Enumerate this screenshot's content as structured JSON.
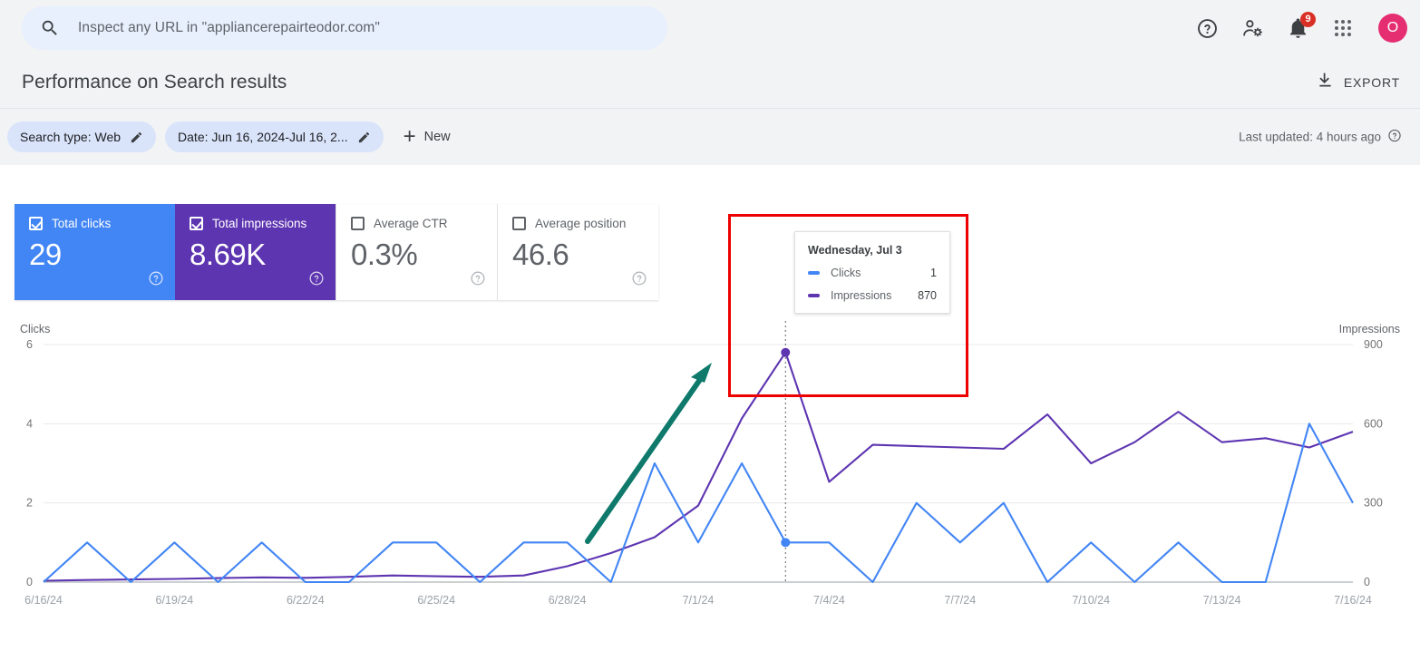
{
  "search": {
    "placeholder": "Inspect any URL in \"appliancerepairteodor.com\"",
    "icon": "search-icon"
  },
  "topbar": {
    "help_icon": "help-circle-icon",
    "account_settings_icon": "account-settings-icon",
    "notifications_icon": "bell-icon",
    "notifications_badge": "9",
    "apps_icon": "apps-grid-icon",
    "avatar_initial": "O",
    "avatar_color": "#e52e71"
  },
  "header": {
    "title": "Performance on Search results",
    "export_label": "EXPORT",
    "export_icon": "download-icon"
  },
  "filters": {
    "chips": [
      {
        "label": "Search type: Web",
        "edit_icon": "pencil-icon"
      },
      {
        "label": "Date: Jun 16, 2024-Jul 16, 2...",
        "edit_icon": "pencil-icon"
      }
    ],
    "new_label": "New",
    "new_icon": "plus-icon",
    "last_updated": "Last updated: 4 hours ago",
    "last_updated_icon": "help-circle-icon"
  },
  "metrics": [
    {
      "label": "Total clicks",
      "value": "29",
      "checked": true,
      "style": "blue",
      "help_icon": "help-circle-icon"
    },
    {
      "label": "Total impressions",
      "value": "8.69K",
      "checked": true,
      "style": "purple",
      "help_icon": "help-circle-icon"
    },
    {
      "label": "Average CTR",
      "value": "0.3%",
      "checked": false,
      "style": "plain",
      "help_icon": "help-circle-icon"
    },
    {
      "label": "Average position",
      "value": "46.6",
      "checked": false,
      "style": "plain",
      "help_icon": "help-circle-icon"
    }
  ],
  "tooltip": {
    "date": "Wednesday, Jul 3",
    "rows": [
      {
        "label": "Clicks",
        "value": "1",
        "color": "#4285f4"
      },
      {
        "label": "Impressions",
        "value": "870",
        "color": "#5e35b1"
      }
    ]
  },
  "annotations": {
    "highlight_box_color": "#ee0000",
    "arrow_color": "#0f7a6c"
  },
  "chart_data": {
    "type": "line",
    "title": "",
    "xlabel": "",
    "grid": true,
    "legend": "none",
    "x": [
      "6/16/24",
      "6/17/24",
      "6/18/24",
      "6/19/24",
      "6/20/24",
      "6/21/24",
      "6/22/24",
      "6/23/24",
      "6/24/24",
      "6/25/24",
      "6/26/24",
      "6/27/24",
      "6/28/24",
      "6/29/24",
      "6/30/24",
      "7/1/24",
      "7/2/24",
      "7/3/24",
      "7/4/24",
      "7/5/24",
      "7/6/24",
      "7/7/24",
      "7/8/24",
      "7/9/24",
      "7/10/24",
      "7/11/24",
      "7/12/24",
      "7/13/24",
      "7/14/24",
      "7/15/24",
      "7/16/24"
    ],
    "xtick_labels": [
      "6/16/24",
      "6/19/24",
      "6/22/24",
      "6/25/24",
      "6/28/24",
      "7/1/24",
      "7/4/24",
      "7/7/24",
      "7/10/24",
      "7/13/24",
      "7/16/24"
    ],
    "xtick_indices": [
      0,
      3,
      6,
      9,
      12,
      15,
      18,
      21,
      24,
      27,
      30
    ],
    "axes": [
      {
        "side": "left",
        "name": "Clicks",
        "ylim": [
          0,
          6
        ],
        "ticks": [
          0,
          2,
          4,
          6
        ],
        "tick_labels": [
          "0",
          "2",
          "4",
          "6"
        ]
      },
      {
        "side": "right",
        "name": "Impressions",
        "ylim": [
          0,
          900
        ],
        "ticks": [
          0,
          300,
          600,
          900
        ],
        "tick_labels": [
          "0",
          "300",
          "600",
          "900"
        ]
      }
    ],
    "series": [
      {
        "name": "Clicks",
        "axis": "left",
        "color": "#4285f4",
        "values": [
          0,
          1,
          0,
          1,
          0,
          1,
          0,
          0,
          1,
          1,
          0,
          1,
          1,
          0,
          3,
          1,
          3,
          1,
          1,
          0,
          2,
          1,
          2,
          0,
          1,
          0,
          1,
          0,
          0,
          4,
          2
        ]
      },
      {
        "name": "Impressions",
        "axis": "right",
        "color": "#5e35b1",
        "values": [
          5,
          8,
          10,
          12,
          15,
          18,
          16,
          20,
          25,
          22,
          20,
          25,
          60,
          110,
          170,
          290,
          620,
          870,
          380,
          520,
          515,
          510,
          505,
          635,
          450,
          530,
          645,
          530,
          545,
          510,
          570
        ]
      }
    ],
    "highlight_point": {
      "x": "7/3/24",
      "clicks": 1,
      "impressions": 870
    }
  }
}
